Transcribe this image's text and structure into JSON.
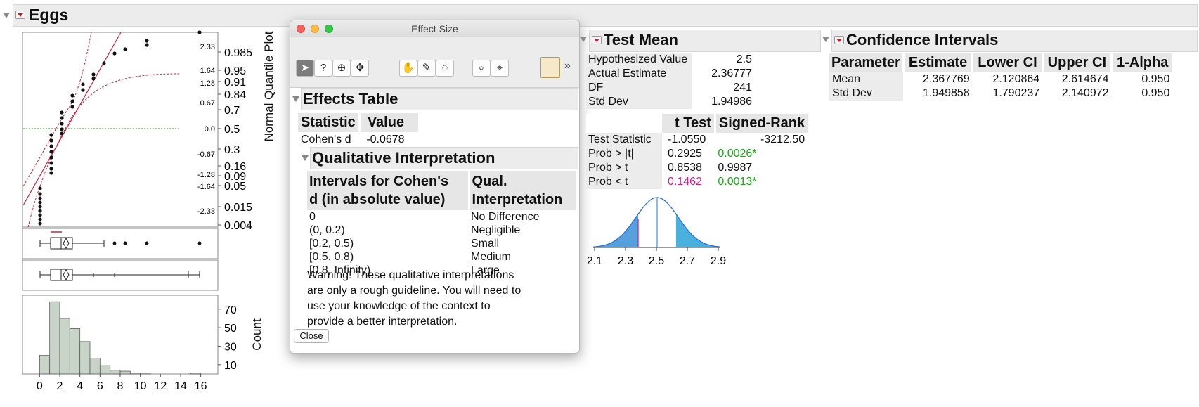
{
  "distribution": {
    "title": "Eggs",
    "quantile_axis_label": "Normal Quantile Plot",
    "quantile_ticks_left": [
      "2.33",
      "1.64",
      "1.28",
      "0.67",
      "0.0",
      "-0.67",
      "-1.28",
      "-1.64",
      "-2.33"
    ],
    "quantile_ticks_right": [
      "0.985",
      "0.95",
      "0.91",
      "0.84",
      "0.7",
      "0.5",
      "0.3",
      "0.16",
      "0.09",
      "0.05",
      "0.015",
      "0.004"
    ],
    "count_label": "Count",
    "count_ticks": [
      "70",
      "50",
      "30",
      "10"
    ],
    "x_ticks": [
      "0",
      "2",
      "4",
      "6",
      "8",
      "10",
      "12",
      "14",
      "16"
    ]
  },
  "chart_data": {
    "type": "bar",
    "xlabel": "",
    "ylabel": "Count",
    "bin_edges": [
      0,
      1,
      2,
      3,
      4,
      5,
      6,
      7,
      8,
      9,
      10,
      11,
      12,
      13,
      14,
      15,
      16
    ],
    "values": [
      20,
      78,
      60,
      49,
      35,
      17,
      9,
      4,
      3,
      1,
      1,
      0,
      0,
      0,
      0,
      1
    ],
    "xlim": [
      -1,
      17
    ],
    "ylim": [
      0,
      85
    ]
  },
  "dialog": {
    "title": "Effect Size",
    "effects_table": {
      "title": "Effects Table",
      "headers": [
        "Statistic",
        "Value"
      ],
      "rows": [
        [
          "Cohen's d",
          "-0.0678"
        ]
      ]
    },
    "qualitative": {
      "title": "Qualitative Interpretation",
      "header_col1_line1": "Intervals for Cohen's",
      "header_col1_line2": "d (in absolute value)",
      "header_col2_line1": "Qual.",
      "header_col2_line2": "Interpretation",
      "rows": [
        [
          "0",
          "No Difference"
        ],
        [
          "(0, 0.2)",
          "Negligible"
        ],
        [
          "[0.2, 0.5)",
          "Small"
        ],
        [
          "[0.5, 0.8)",
          "Medium"
        ],
        [
          "[0.8, Infinity)",
          "Large"
        ]
      ],
      "warning": [
        "Warning! These qualitative interpretations",
        "are only a rough guideline. You will need to",
        "use your knowledge of the context to",
        "provide a better interpretation."
      ]
    },
    "close_label": "Close"
  },
  "test_mean": {
    "title": "Test Mean",
    "summary": [
      [
        "Hypothesized Value",
        "2.5"
      ],
      [
        "Actual Estimate",
        "2.36777"
      ],
      [
        "DF",
        "241"
      ],
      [
        "Std Dev",
        "1.94986"
      ]
    ],
    "headers": [
      "",
      "t Test",
      "Signed-Rank"
    ],
    "rows": [
      [
        "Test Statistic",
        "-1.0550",
        "-3212.50"
      ],
      [
        "Prob > |t|",
        "0.2925",
        "0.0026*"
      ],
      [
        "Prob > t",
        "0.8538",
        "0.9987"
      ],
      [
        "Prob < t",
        "0.1462",
        "0.0013*"
      ]
    ],
    "curve_ticks": [
      "2.1",
      "2.3",
      "2.5",
      "2.7",
      "2.9"
    ],
    "colors": {
      "significant": "#1aa71a",
      "pink": "#e01c8a",
      "fill": "#3a8fd8"
    }
  },
  "confidence_intervals": {
    "title": "Confidence Intervals",
    "headers": [
      "Parameter",
      "Estimate",
      "Lower CI",
      "Upper CI",
      "1-Alpha"
    ],
    "rows": [
      [
        "Mean",
        "2.367769",
        "2.120864",
        "2.614674",
        "0.950"
      ],
      [
        "Std Dev",
        "1.949858",
        "1.790237",
        "2.140972",
        "0.950"
      ]
    ]
  }
}
